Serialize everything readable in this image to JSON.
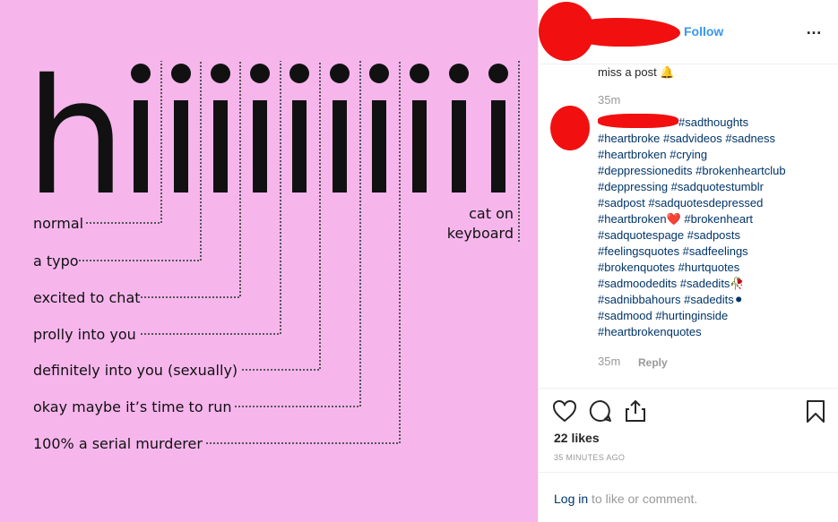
{
  "meme": {
    "big_letter": "h",
    "labels": [
      "normal",
      "a typo",
      "excited to chat",
      "prolly into you",
      "definitely into you (sexually)",
      "okay maybe it’s time to run",
      "100% a serial murderer"
    ],
    "cat_label_line1": "cat on",
    "cat_label_line2": "keyboard"
  },
  "post": {
    "follow_label": "Follow",
    "more_label": "…",
    "caption_text": "miss a post",
    "caption_emoji": "🔔",
    "caption_time": "35m",
    "comment_first_tag": "#sadthoughts",
    "hashtag_lines": [
      "#heartbroke #sadvideos #sadness",
      "#heartbroken #crying",
      "#deppressionedits #brokenheartclub",
      "#deppressing #sadquotestumblr",
      "#sadpost #sadquotesdepressed",
      "#heartbroken❤️ #brokenheart",
      "#sadquotespage #sadposts",
      "#feelingsquotes #sadfeelings",
      "#brokenquotes #hurtquotes",
      "#sadmoodedits #sadedits🥀",
      "#sadnibbahours #sadedits⚫",
      "#sadmood #hurtinginside",
      "#heartbrokenquotes"
    ],
    "comment_time": "35m",
    "reply_label": "Reply",
    "likes": "22 likes",
    "time_ago": "35 MINUTES AGO",
    "login_link": "Log in",
    "login_rest": " to like or comment."
  },
  "icons": {
    "like": "heart-icon",
    "comment": "comment-icon",
    "share": "share-icon",
    "save": "bookmark-icon",
    "more": "more-icon"
  },
  "colors": {
    "meme_background": "#f6b6ec",
    "follow_blue": "#3897f0",
    "hashtag_navy": "#003569",
    "redaction_red": "#f20f0f"
  }
}
